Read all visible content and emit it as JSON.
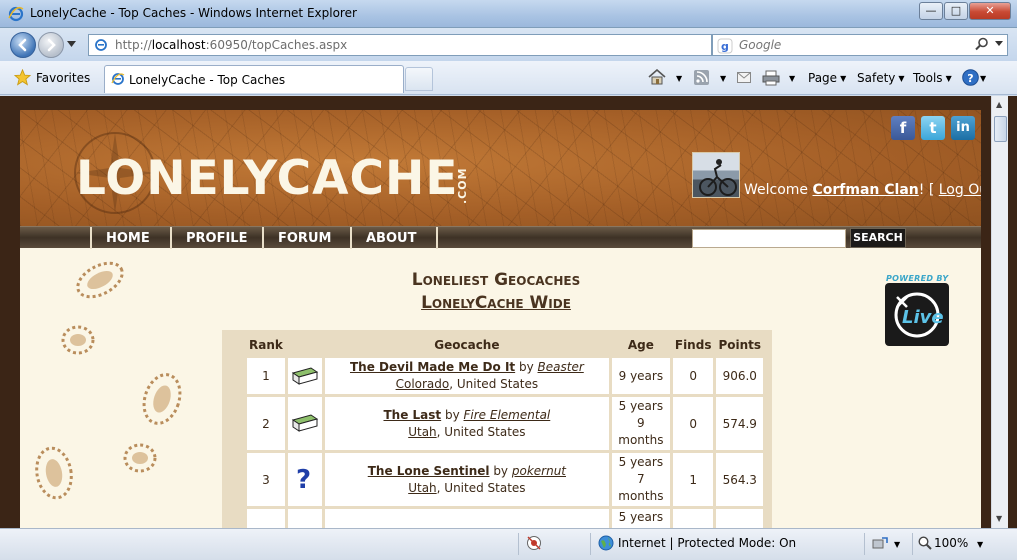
{
  "window": {
    "title": "LonelyCache - Top Caches - Windows Internet Explorer",
    "min_glyph": "—",
    "max_glyph": "□",
    "close_glyph": "✕"
  },
  "address": {
    "url_prefix": "http://",
    "url_host": "localhost",
    "url_rest": ":60950/topCaches.aspx",
    "search_placeholder": "Google"
  },
  "favbar": {
    "favorites_label": "Favorites",
    "tab_title": "LonelyCache - Top Caches",
    "commands": [
      "Page",
      "Safety",
      "Tools"
    ]
  },
  "site": {
    "logo_text": "LONELYCACHE",
    "logo_suffix": ".COM",
    "social": [
      "f",
      "t",
      "in"
    ],
    "welcome_prefix": "Welcome ",
    "username": "Corfman Clan",
    "welcome_mid": "! [ ",
    "logout": "Log Out",
    "welcome_suffix": " ]",
    "nav": [
      "HOME",
      "PROFILE",
      "FORUM",
      "ABOUT"
    ],
    "search_button": "SEARCH",
    "heading1": "Loneliest Geocaches",
    "heading2": "LonelyCache Wide",
    "powered_by": "POWERED BY",
    "live_text": "Live"
  },
  "table": {
    "headers": [
      "Rank",
      "",
      "Geocache",
      "Age",
      "Finds",
      "Points"
    ],
    "rows": [
      {
        "rank": "1",
        "icon": "traditional-cache-icon",
        "name": "The Devil Made Me Do It",
        "by": " by ",
        "owner": "Beaster",
        "state": "Colorado",
        "country": ", United States",
        "age_lines": [
          "9 years"
        ],
        "finds": "0",
        "points": "906.0"
      },
      {
        "rank": "2",
        "icon": "traditional-cache-icon",
        "name": "The Last",
        "by": " by ",
        "owner": "Fire Elemental",
        "state": "Utah",
        "country": ", United States",
        "age_lines": [
          "5 years",
          "9",
          "months"
        ],
        "finds": "0",
        "points": "574.9"
      },
      {
        "rank": "3",
        "icon": "mystery-cache-icon",
        "name": "The Lone Sentinel",
        "by": " by ",
        "owner": "pokernut",
        "state": "Utah",
        "country": ", United States",
        "age_lines": [
          "5 years",
          "7",
          "months"
        ],
        "finds": "1",
        "points": "564.3"
      },
      {
        "rank": "",
        "icon": "traditional-cache-icon",
        "name": "",
        "by": "",
        "owner": "",
        "state": "",
        "country": "",
        "age_lines": [
          "5 years"
        ],
        "finds": "",
        "points": ""
      }
    ]
  },
  "status": {
    "zone": "Internet | Protected Mode: On",
    "zoom": "100%"
  },
  "colors": {
    "header_brown": "#a45f27",
    "page_cream": "#fbf6e6",
    "text_brown": "#3d2a18",
    "table_bg": "#e8dcc3",
    "live_blue": "#3aa6c9"
  }
}
